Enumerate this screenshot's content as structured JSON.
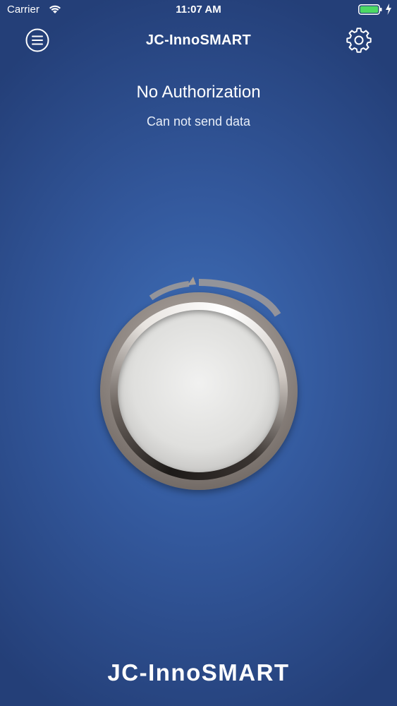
{
  "status_bar": {
    "carrier": "Carrier",
    "time": "11:07 AM",
    "icons": {
      "wifi": "wifi-icon",
      "battery": "battery-icon",
      "charging": "charging-bolt-icon"
    },
    "battery_color": "#4cd964"
  },
  "nav": {
    "title": "JC-InnoSMART",
    "menu_icon": "menu-icon",
    "settings_icon": "gear-icon"
  },
  "status": {
    "title": "No Authorization",
    "subtitle": "Can not send data"
  },
  "knob": {
    "icon": "rotary-knob-icon"
  },
  "footer": {
    "brand": "JC-InnoSMART"
  },
  "colors": {
    "background": "#33589c",
    "text": "#ffffff"
  }
}
